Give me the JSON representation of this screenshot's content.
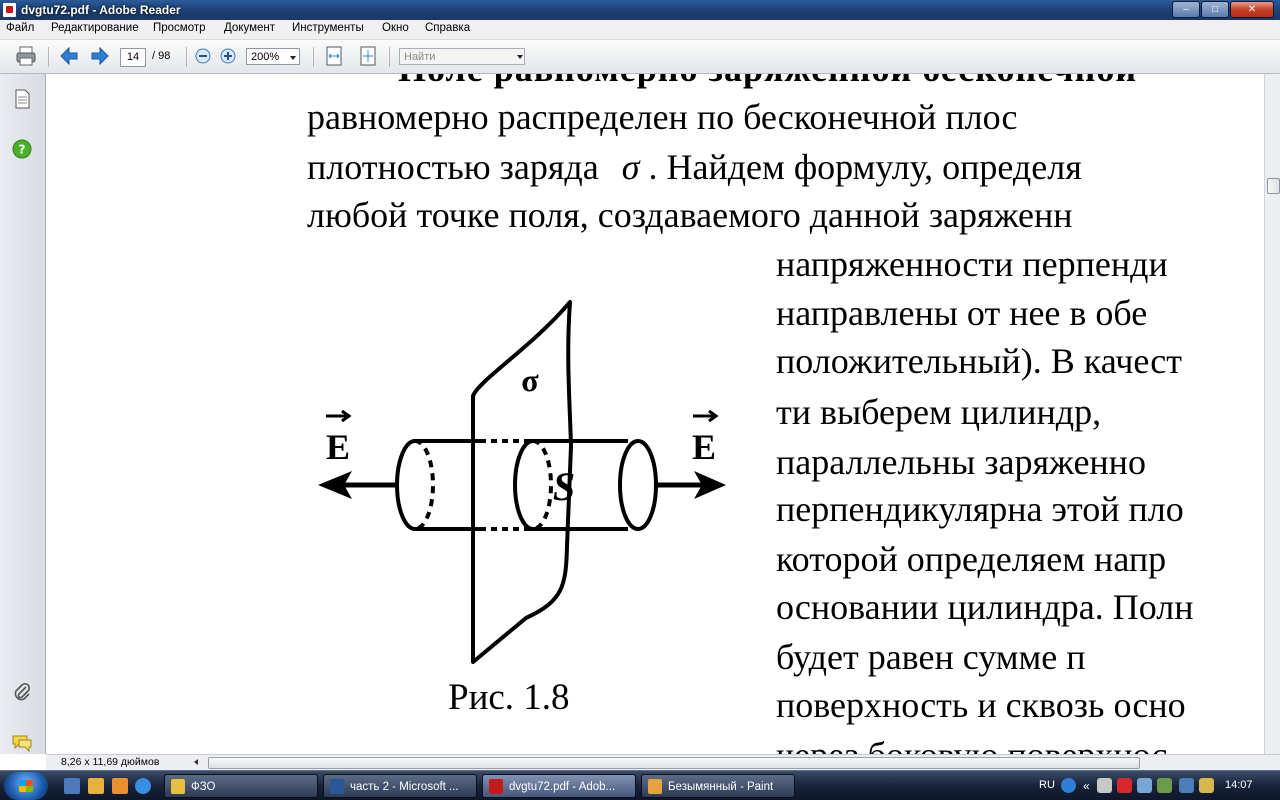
{
  "window": {
    "title": "dvgtu72.pdf - Adobe Reader",
    "controls": {
      "minimize": "–",
      "maximize": "□",
      "close": "✕"
    }
  },
  "menu": [
    "Файл",
    "Редактирование",
    "Просмотр",
    "Документ",
    "Инструменты",
    "Окно",
    "Справка"
  ],
  "toolbar": {
    "page_current": "14",
    "page_total": "/  98",
    "zoom": "200%",
    "find_placeholder": "Найти"
  },
  "document": {
    "lines_top": [
      "Поле  равномерно  заряженной  бесконечной",
      "равномерно   распределен   по   бесконечной   плос",
      "плотностью  заряда",
      ". Найдем формулу, определя",
      "любой  точке  поля,  создаваемого  данной  заряженн"
    ],
    "sigma_symbol": "σ",
    "lines_right": [
      "напряженности    перпенди",
      "направлены  от  нее  в  обе",
      "положительный).  В  качест",
      "ти      выберем      цилиндр,",
      "параллельны       заряженно",
      "перпендикулярна этой пло",
      "которой  определяем  напр",
      "основании цилиндра. Полн",
      "будет       равен       сумме       п",
      "поверхность и сквозь осно",
      "через  боковую  поверхнос"
    ],
    "figure": {
      "label_sigma": "σ",
      "label_s": "S",
      "label_e_left": "E",
      "label_e_right": "E",
      "caption": "Рис. 1.8"
    }
  },
  "status": {
    "page_size": "8,26 x 11,69 дюймов"
  },
  "taskbar": {
    "tasks": [
      {
        "label": "ФЗО",
        "color": "#e8c040"
      },
      {
        "label": "часть 2 - Microsoft ...",
        "color": "#2b5797"
      },
      {
        "label": "dvgtu72.pdf - Adob...",
        "color": "#c41a1a"
      },
      {
        "label": "Безымянный - Paint",
        "color": "#e6a23c"
      }
    ],
    "language": "RU",
    "clock": "14:07"
  },
  "colors": {
    "titlebar": "#1d3f73",
    "toolbar_arrow": "#2f7fd8",
    "help_icon": "#4caf2a"
  }
}
